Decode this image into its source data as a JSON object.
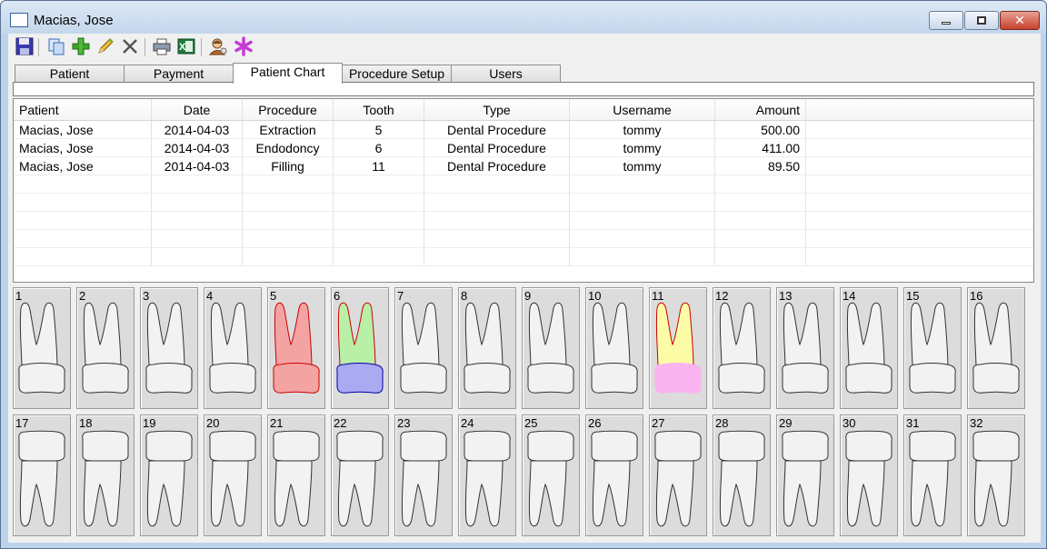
{
  "window": {
    "title": "Macias, Jose"
  },
  "toolbar": {
    "buttons": [
      {
        "name": "save-icon"
      },
      {
        "name": "copy-icon"
      },
      {
        "name": "add-icon"
      },
      {
        "name": "edit-pencil-icon"
      },
      {
        "name": "delete-x-icon"
      },
      {
        "name": "print-icon"
      },
      {
        "name": "excel-export-icon"
      },
      {
        "name": "user-icon"
      },
      {
        "name": "asterisk-icon"
      }
    ]
  },
  "tabs": [
    {
      "label": "Patient"
    },
    {
      "label": "Payment"
    },
    {
      "label": "Patient Chart",
      "active": true
    },
    {
      "label": "Procedure Setup"
    },
    {
      "label": "Users"
    }
  ],
  "grid": {
    "columns": [
      "Patient",
      "Date",
      "Procedure",
      "Tooth",
      "Type",
      "Username",
      "Amount"
    ],
    "rows": [
      [
        "Macias, Jose",
        "2014-04-03",
        "Extraction",
        "5",
        "Dental Procedure",
        "tommy",
        "500.00"
      ],
      [
        "Macias, Jose",
        "2014-04-03",
        "Endodoncy",
        "6",
        "Dental Procedure",
        "tommy",
        "411.00"
      ],
      [
        "Macias, Jose",
        "2014-04-03",
        "Filling",
        "11",
        "Dental Procedure",
        "tommy",
        "89.50"
      ]
    ]
  },
  "teeth": {
    "upper": [
      "1",
      "2",
      "3",
      "4",
      "5",
      "6",
      "7",
      "8",
      "9",
      "10",
      "11",
      "12",
      "13",
      "14",
      "15",
      "16"
    ],
    "lower": [
      "17",
      "18",
      "19",
      "20",
      "21",
      "22",
      "23",
      "24",
      "25",
      "26",
      "27",
      "28",
      "29",
      "30",
      "31",
      "32"
    ],
    "highlights": {
      "5": {
        "root": "#f4a3a3",
        "crown": "#f4a3a3",
        "outline": "#cc0000"
      },
      "6": {
        "root": "#b9f0a8",
        "crown": "#a9aaf2",
        "outline_root": "#cc0000",
        "outline_crown": "#0000aa"
      },
      "11": {
        "root": "#fdfca6",
        "crown": "#f9b4f0",
        "outline_root": "#cc0000",
        "outline_crown": "#f9b4f0"
      }
    },
    "default_fill": "#f2f2f2"
  }
}
